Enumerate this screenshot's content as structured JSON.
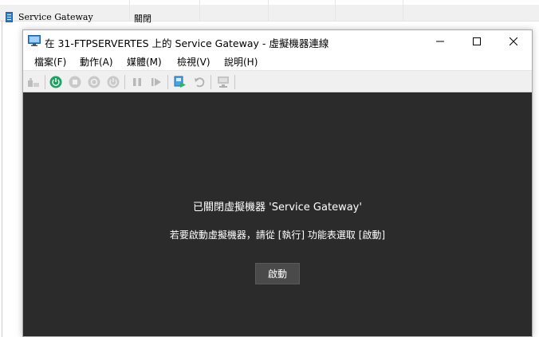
{
  "background_list": {
    "vm_name": "Service Gateway",
    "vm_state": "關閉"
  },
  "window": {
    "title": "在 31-FTPSERVERTES 上的 Service Gateway - 虛擬機器連線",
    "controls": {
      "minimize": "minimize",
      "maximize": "maximize",
      "close": "close"
    }
  },
  "menu": [
    {
      "label": "檔案(F)"
    },
    {
      "label": "動作(A)"
    },
    {
      "label": "媒體(M)"
    },
    {
      "label": "檢視(V)"
    },
    {
      "label": "說明(H)"
    }
  ],
  "toolbar": {
    "icons": [
      "ctrl-alt-del-icon",
      "start-icon",
      "turn-off-icon",
      "shut-down-icon",
      "power-icon",
      "pause-icon",
      "reset-icon",
      "checkpoint-icon",
      "revert-icon",
      "enhanced-session-icon"
    ],
    "start_color": "#1aa260"
  },
  "screen": {
    "message_title": "已關閉虛擬機器 'Service Gateway'",
    "message_sub": "若要啟動虛擬機器，請從 [執行] 功能表選取 [啟動]",
    "start_button": "啟動",
    "background_color": "#2b2b2b"
  }
}
